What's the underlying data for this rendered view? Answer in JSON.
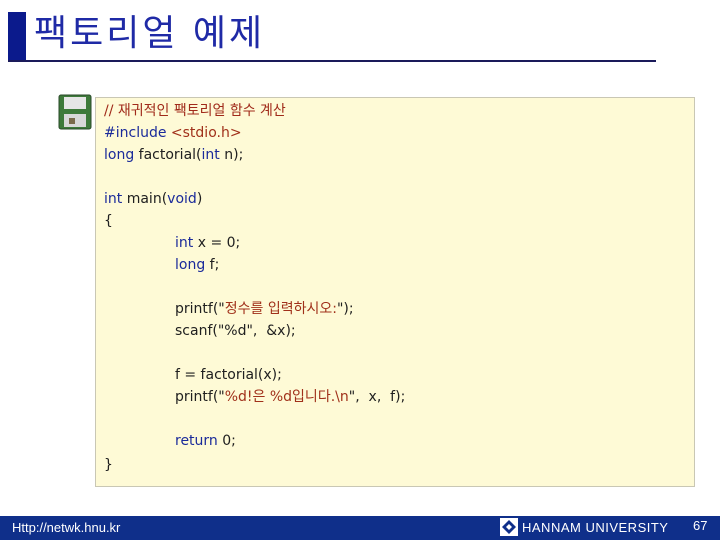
{
  "slide": {
    "title": "팩토리얼 예제",
    "code": {
      "comment": "// 재귀적인 팩토리얼 함수 계산",
      "include_kw": "#include",
      "include_rest": " <stdio.h>",
      "proto_kw": "long",
      "proto_mid": " factorial(",
      "proto_kw2": "int",
      "proto_end": " n);",
      "main_kw": "int",
      "main_mid": " main(",
      "main_kw2": "void",
      "main_end": ")",
      "brace_open": "{",
      "decl1_kw": "int",
      "decl1_rest": " x = 0;",
      "decl2_kw": "long",
      "decl2_rest": " f;",
      "printf1_start": "printf(\"",
      "printf1_str": "정수를 입력하시오:",
      "printf1_end": "\");",
      "scanf": "scanf(\"%d\",  &x);",
      "assign": "f = factorial(x);",
      "printf2_start": "printf(\"",
      "printf2_str": "%d!은 %d입니다.\\n",
      "printf2_end": "\",  x,  f);",
      "return_kw": "return",
      "return_rest": " 0;",
      "brace_close": "}"
    },
    "icon": "floppy-disk-icon"
  },
  "footer": {
    "url": "Http://netwk.hnu.kr",
    "university": "HANNAM  UNIVERSITY",
    "page": "67",
    "logo_icon": "university-logo-icon"
  }
}
